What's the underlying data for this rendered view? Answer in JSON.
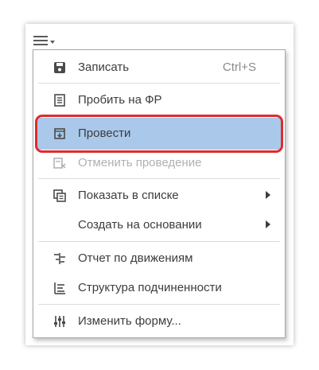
{
  "menu_button": {
    "icon": "hamburger-menu-icon"
  },
  "menu": {
    "items": [
      {
        "label": "Записать",
        "shortcut": "Ctrl+S",
        "icon": "save-icon"
      },
      {
        "label": "Пробить на ФР",
        "icon": "receipt-icon"
      },
      {
        "label": "Провести",
        "icon": "post-document-icon",
        "selected": true
      },
      {
        "label": "Отменить проведение",
        "icon": "cancel-posting-icon",
        "disabled": true
      },
      {
        "label": "Показать в списке",
        "icon": "show-in-list-icon",
        "submenu": true
      },
      {
        "label": "Создать на основании",
        "submenu": true
      },
      {
        "label": "Отчет по движениям",
        "icon": "movements-report-icon"
      },
      {
        "label": "Структура подчиненности",
        "icon": "hierarchy-structure-icon"
      },
      {
        "label": "Изменить форму...",
        "icon": "sliders-icon"
      }
    ]
  },
  "colors": {
    "highlight": "#a9c8ea",
    "highlight_ring": "#e02b2b",
    "disabled_text": "#b0b0b0"
  }
}
